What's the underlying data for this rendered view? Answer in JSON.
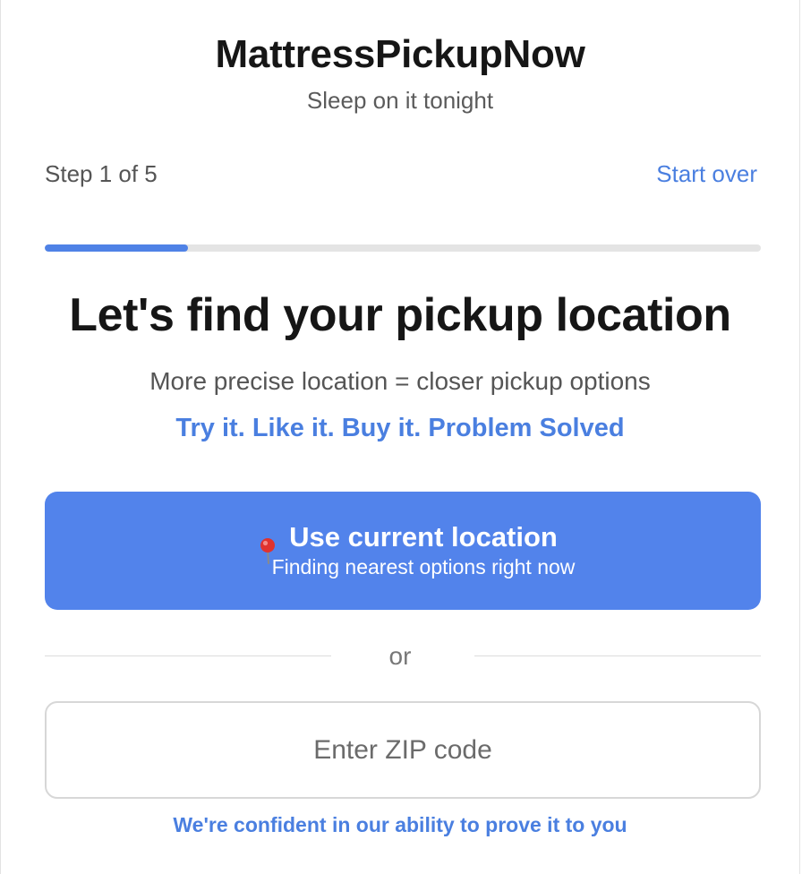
{
  "header": {
    "title": "MattressPickupNow",
    "tagline": "Sleep on it tonight"
  },
  "progress": {
    "step_label": "Step 1 of 5",
    "start_over_label": "Start over",
    "fraction": 0.2,
    "fill_color": "#4f82e6",
    "track_color": "#e4e4e4"
  },
  "main": {
    "headline": "Let's find your pickup location",
    "subtext": "More precise location = closer pickup options",
    "slogan": "Try it. Like it. Buy it. Problem Solved"
  },
  "location_button": {
    "icon": "pushpin-icon",
    "title": "Use current location",
    "subtitle": "Finding nearest options right now",
    "color": "#5283eb"
  },
  "divider": {
    "label": "or"
  },
  "zip": {
    "value": "",
    "placeholder": "Enter ZIP code"
  },
  "footer": {
    "note": "We're confident in our ability to prove it to you"
  },
  "colors": {
    "accent": "#4a7fe0",
    "text_primary": "#161616",
    "text_secondary": "#555555"
  }
}
